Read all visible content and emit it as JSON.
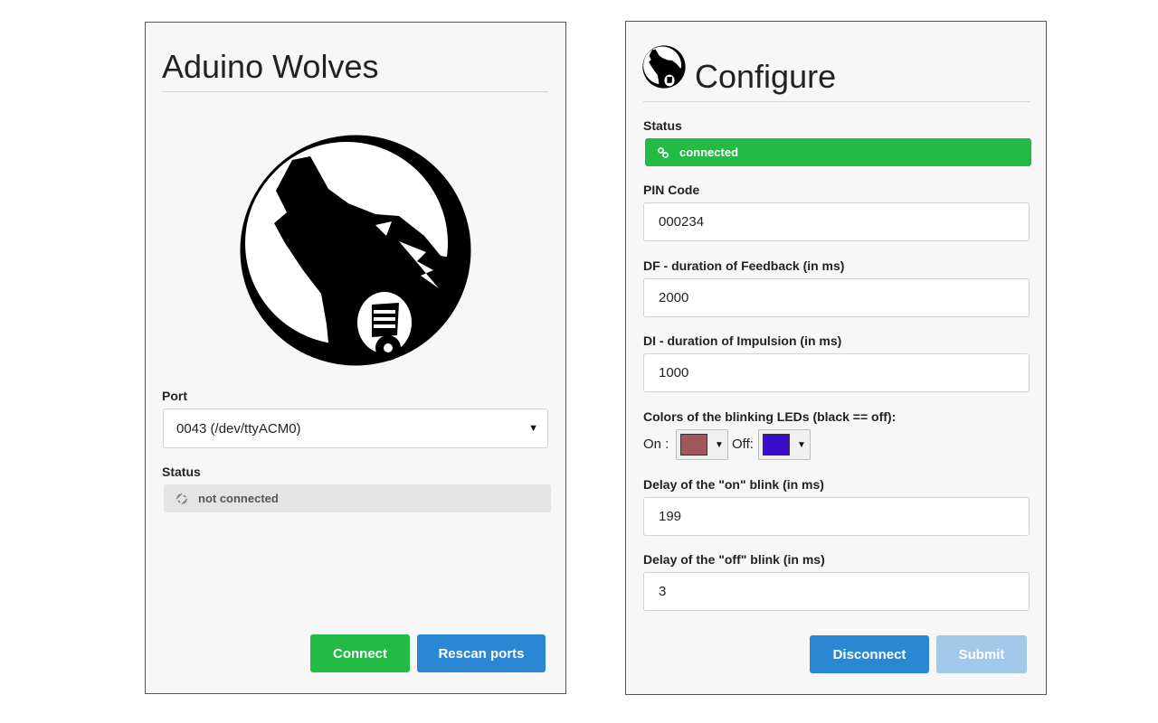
{
  "left": {
    "title": "Aduino Wolves",
    "port_label": "Port",
    "port_value": "0043 (/dev/ttyACM0)",
    "status_label": "Status",
    "status_text": "not connected",
    "connect_label": "Connect",
    "rescan_label": "Rescan ports"
  },
  "right": {
    "title": "Configure",
    "status_label": "Status",
    "status_text": "connected",
    "pin_label": "PIN Code",
    "pin_value": "000234",
    "df_label": "DF - duration of Feedback (in ms)",
    "df_value": "2000",
    "di_label": "DI - duration of Impulsion (in ms)",
    "di_value": "1000",
    "colors_label": "Colors of the blinking LEDs (black == off):",
    "on_label": "On :",
    "off_label": "Off:",
    "on_color": "#a0585a",
    "off_color": "#3a0ccc",
    "delay_on_label": "Delay of the \"on\" blink (in ms)",
    "delay_on_value": "199",
    "delay_off_label": "Delay of the \"off\" blink (in ms)",
    "delay_off_value": "3",
    "disconnect_label": "Disconnect",
    "submit_label": "Submit"
  },
  "icons": {
    "wolf_logo": "wolf-logo-icon",
    "link": "link-icon",
    "unlink": "unlink-icon"
  },
  "colors": {
    "green": "#22bb44",
    "blue": "#2a87d4",
    "blue_disabled": "#a3c9ea",
    "gray_status": "#e4e4e4"
  }
}
